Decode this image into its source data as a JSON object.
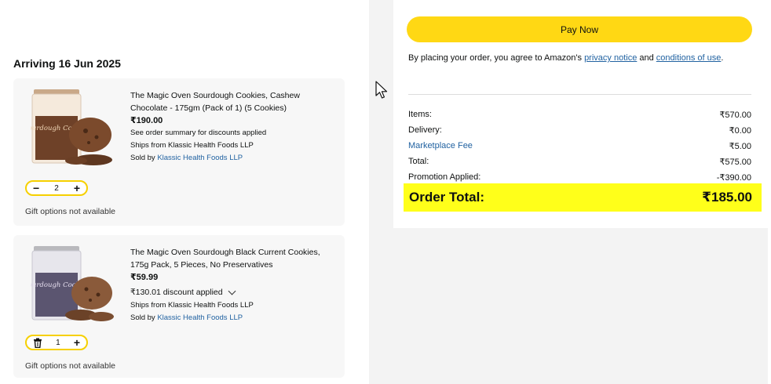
{
  "delivery": {
    "arriving": "Arriving 16 Jun 2025"
  },
  "items": [
    {
      "title": "The Magic Oven Sourdough Cookies, Cashew Chocolate - 175gm (Pack of 1) (5 Cookies)",
      "price": "₹190.00",
      "note": "See order summary for discounts applied",
      "ships_from": "Ships from Klassic Health Foods LLP",
      "sold_by_prefix": "Sold by",
      "seller": "Klassic Health Foods LLP",
      "quantity": "2",
      "gift": "Gift options not available",
      "image_text": "Sourdough Cookies",
      "colors": {
        "lid": "#c9a989",
        "can": "#f5eadc",
        "cookie": "#7b4a2c"
      }
    },
    {
      "title": "The Magic Oven Sourdough Black Current Cookies, 175g Pack, 5 Pieces, No Preservatives",
      "price": "₹59.99",
      "discount": "₹130.01 discount applied",
      "ships_from": "Ships from Klassic Health Foods LLP",
      "sold_by_prefix": "Sold by",
      "seller": "Klassic Health Foods LLP",
      "quantity": "1",
      "gift": "Gift options not available",
      "image_text": "Sourdough Cookies",
      "colors": {
        "lid": "#b9b9bd",
        "can": "#e7e6ec",
        "cookie": "#8a5a3a"
      }
    }
  ],
  "summary": {
    "pay_label": "Pay Now",
    "agree_prefix": "By placing your order, you agree to Amazon's ",
    "privacy_link": "privacy notice",
    "agree_and": " and ",
    "conditions_link": "conditions of use",
    "agree_end": ".",
    "rows": [
      {
        "label": "Items:",
        "value": "₹570.00"
      },
      {
        "label": "Delivery:",
        "value": "₹0.00"
      },
      {
        "label": "Marketplace Fee",
        "value": "₹5.00"
      },
      {
        "label": "Total:",
        "value": "₹575.00"
      },
      {
        "label": "Promotion Applied:",
        "value": "-₹390.00"
      }
    ],
    "order_total_label": "Order Total:",
    "order_total_value": "₹185.00"
  },
  "theme": {
    "accent_yellow": "#ffd814",
    "highlight_yellow": "#ffff1a",
    "link_blue": "#2162a1",
    "stepper_border": "#f6d000"
  },
  "icons": {
    "minus": "minus-icon",
    "plus": "plus-icon",
    "trash": "trash-icon",
    "chevron": "chevron-down-icon",
    "cursor": "mouse-cursor-icon"
  }
}
